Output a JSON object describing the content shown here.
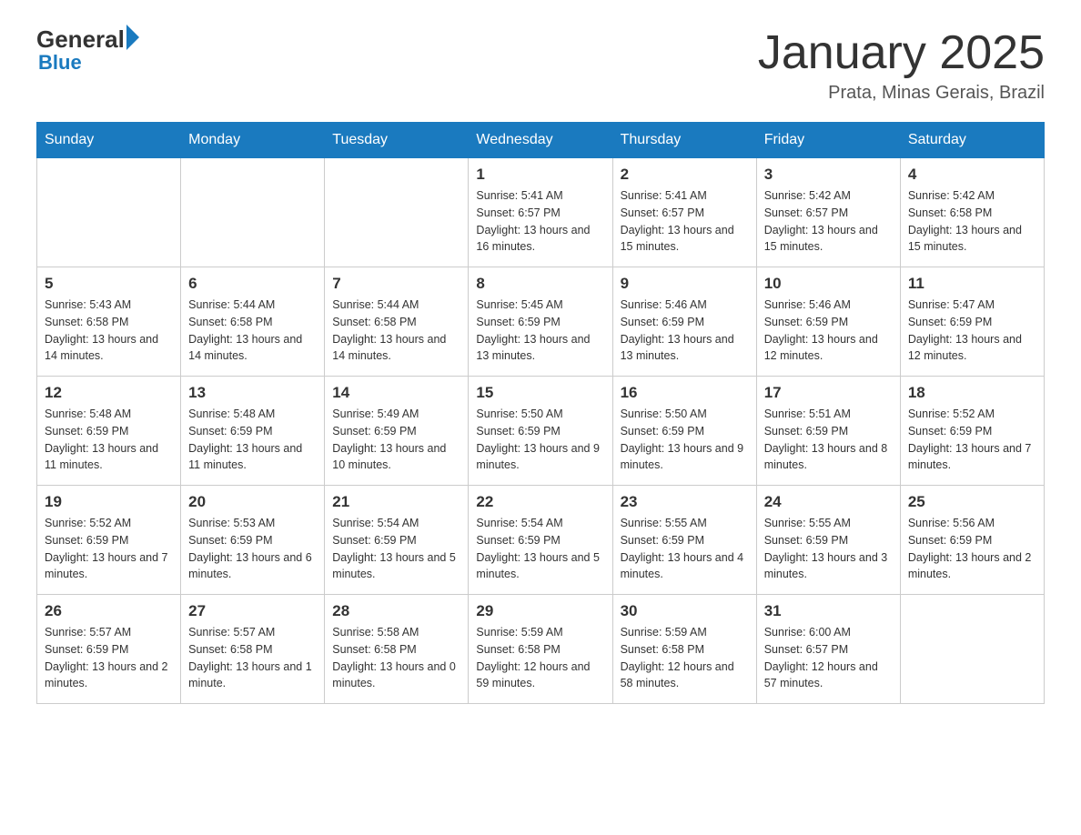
{
  "header": {
    "logo_line1": "General",
    "logo_line2": "Blue",
    "title": "January 2025",
    "subtitle": "Prata, Minas Gerais, Brazil"
  },
  "days_of_week": [
    "Sunday",
    "Monday",
    "Tuesday",
    "Wednesday",
    "Thursday",
    "Friday",
    "Saturday"
  ],
  "weeks": [
    [
      {
        "day": "",
        "info": ""
      },
      {
        "day": "",
        "info": ""
      },
      {
        "day": "",
        "info": ""
      },
      {
        "day": "1",
        "info": "Sunrise: 5:41 AM\nSunset: 6:57 PM\nDaylight: 13 hours and 16 minutes."
      },
      {
        "day": "2",
        "info": "Sunrise: 5:41 AM\nSunset: 6:57 PM\nDaylight: 13 hours and 15 minutes."
      },
      {
        "day": "3",
        "info": "Sunrise: 5:42 AM\nSunset: 6:57 PM\nDaylight: 13 hours and 15 minutes."
      },
      {
        "day": "4",
        "info": "Sunrise: 5:42 AM\nSunset: 6:58 PM\nDaylight: 13 hours and 15 minutes."
      }
    ],
    [
      {
        "day": "5",
        "info": "Sunrise: 5:43 AM\nSunset: 6:58 PM\nDaylight: 13 hours and 14 minutes."
      },
      {
        "day": "6",
        "info": "Sunrise: 5:44 AM\nSunset: 6:58 PM\nDaylight: 13 hours and 14 minutes."
      },
      {
        "day": "7",
        "info": "Sunrise: 5:44 AM\nSunset: 6:58 PM\nDaylight: 13 hours and 14 minutes."
      },
      {
        "day": "8",
        "info": "Sunrise: 5:45 AM\nSunset: 6:59 PM\nDaylight: 13 hours and 13 minutes."
      },
      {
        "day": "9",
        "info": "Sunrise: 5:46 AM\nSunset: 6:59 PM\nDaylight: 13 hours and 13 minutes."
      },
      {
        "day": "10",
        "info": "Sunrise: 5:46 AM\nSunset: 6:59 PM\nDaylight: 13 hours and 12 minutes."
      },
      {
        "day": "11",
        "info": "Sunrise: 5:47 AM\nSunset: 6:59 PM\nDaylight: 13 hours and 12 minutes."
      }
    ],
    [
      {
        "day": "12",
        "info": "Sunrise: 5:48 AM\nSunset: 6:59 PM\nDaylight: 13 hours and 11 minutes."
      },
      {
        "day": "13",
        "info": "Sunrise: 5:48 AM\nSunset: 6:59 PM\nDaylight: 13 hours and 11 minutes."
      },
      {
        "day": "14",
        "info": "Sunrise: 5:49 AM\nSunset: 6:59 PM\nDaylight: 13 hours and 10 minutes."
      },
      {
        "day": "15",
        "info": "Sunrise: 5:50 AM\nSunset: 6:59 PM\nDaylight: 13 hours and 9 minutes."
      },
      {
        "day": "16",
        "info": "Sunrise: 5:50 AM\nSunset: 6:59 PM\nDaylight: 13 hours and 9 minutes."
      },
      {
        "day": "17",
        "info": "Sunrise: 5:51 AM\nSunset: 6:59 PM\nDaylight: 13 hours and 8 minutes."
      },
      {
        "day": "18",
        "info": "Sunrise: 5:52 AM\nSunset: 6:59 PM\nDaylight: 13 hours and 7 minutes."
      }
    ],
    [
      {
        "day": "19",
        "info": "Sunrise: 5:52 AM\nSunset: 6:59 PM\nDaylight: 13 hours and 7 minutes."
      },
      {
        "day": "20",
        "info": "Sunrise: 5:53 AM\nSunset: 6:59 PM\nDaylight: 13 hours and 6 minutes."
      },
      {
        "day": "21",
        "info": "Sunrise: 5:54 AM\nSunset: 6:59 PM\nDaylight: 13 hours and 5 minutes."
      },
      {
        "day": "22",
        "info": "Sunrise: 5:54 AM\nSunset: 6:59 PM\nDaylight: 13 hours and 5 minutes."
      },
      {
        "day": "23",
        "info": "Sunrise: 5:55 AM\nSunset: 6:59 PM\nDaylight: 13 hours and 4 minutes."
      },
      {
        "day": "24",
        "info": "Sunrise: 5:55 AM\nSunset: 6:59 PM\nDaylight: 13 hours and 3 minutes."
      },
      {
        "day": "25",
        "info": "Sunrise: 5:56 AM\nSunset: 6:59 PM\nDaylight: 13 hours and 2 minutes."
      }
    ],
    [
      {
        "day": "26",
        "info": "Sunrise: 5:57 AM\nSunset: 6:59 PM\nDaylight: 13 hours and 2 minutes."
      },
      {
        "day": "27",
        "info": "Sunrise: 5:57 AM\nSunset: 6:58 PM\nDaylight: 13 hours and 1 minute."
      },
      {
        "day": "28",
        "info": "Sunrise: 5:58 AM\nSunset: 6:58 PM\nDaylight: 13 hours and 0 minutes."
      },
      {
        "day": "29",
        "info": "Sunrise: 5:59 AM\nSunset: 6:58 PM\nDaylight: 12 hours and 59 minutes."
      },
      {
        "day": "30",
        "info": "Sunrise: 5:59 AM\nSunset: 6:58 PM\nDaylight: 12 hours and 58 minutes."
      },
      {
        "day": "31",
        "info": "Sunrise: 6:00 AM\nSunset: 6:57 PM\nDaylight: 12 hours and 57 minutes."
      },
      {
        "day": "",
        "info": ""
      }
    ]
  ]
}
